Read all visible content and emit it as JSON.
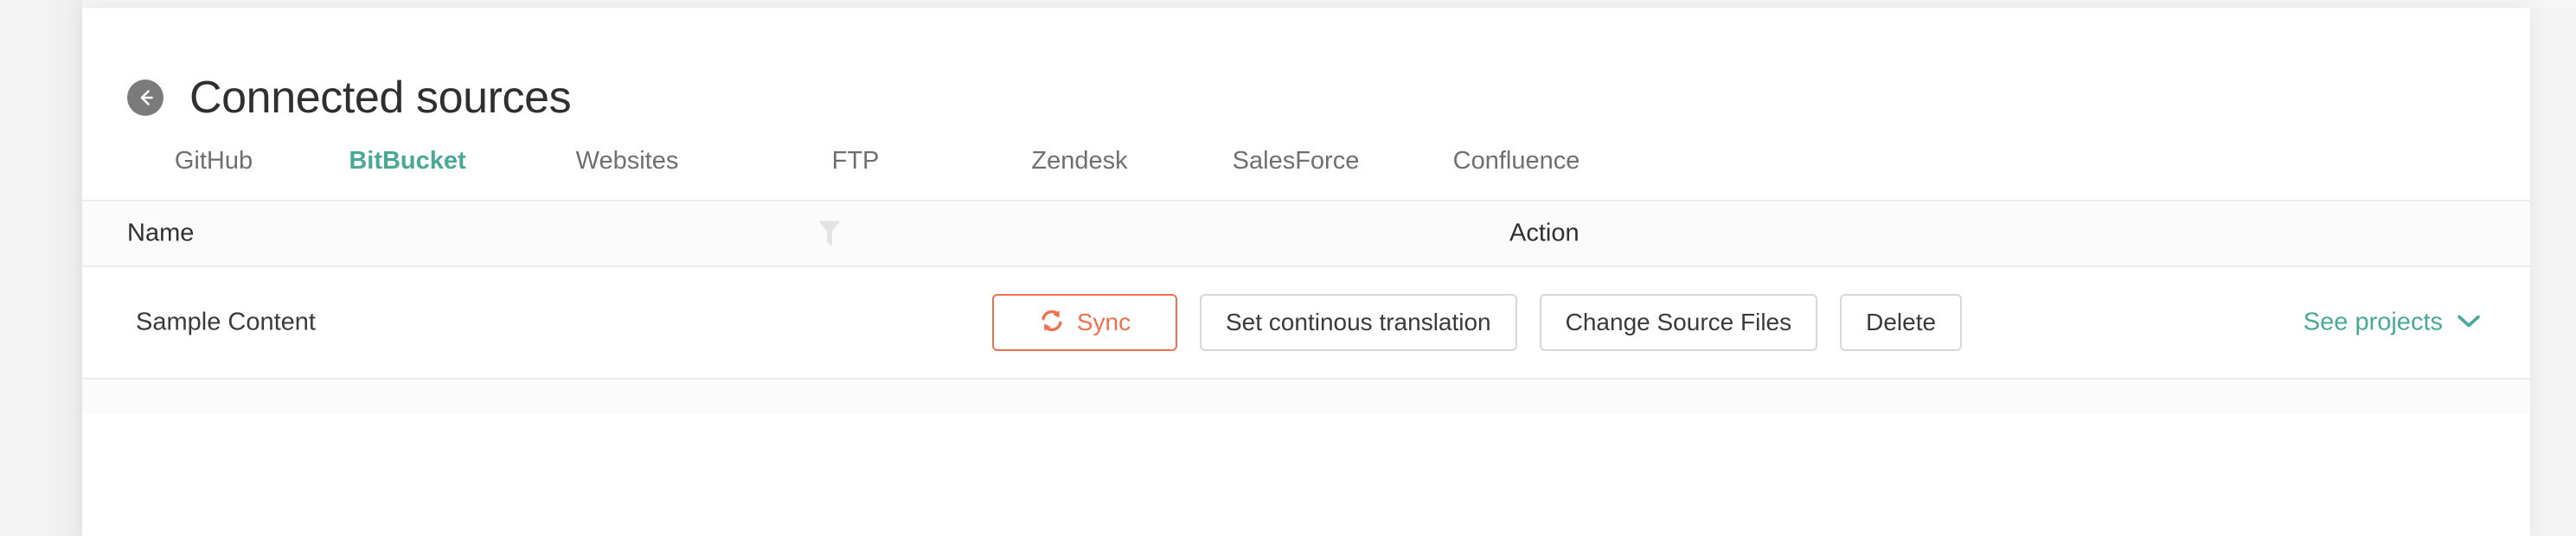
{
  "header": {
    "back_icon": "arrow-left-icon",
    "title": "Connected sources"
  },
  "tabs": [
    {
      "label": "GitHub",
      "active": false
    },
    {
      "label": "BitBucket",
      "active": true
    },
    {
      "label": "Websites",
      "active": false
    },
    {
      "label": "FTP",
      "active": false
    },
    {
      "label": "Zendesk",
      "active": false
    },
    {
      "label": "SalesForce",
      "active": false
    },
    {
      "label": "Confluence",
      "active": false
    }
  ],
  "table": {
    "columns": {
      "name": "Name",
      "filter_icon": "filter-funnel-icon",
      "action": "Action"
    },
    "rows": [
      {
        "name": "Sample Content",
        "actions": {
          "sync": "Sync",
          "sync_icon": "refresh-sync-icon",
          "set_continuous_translation": "Set continous translation",
          "change_source_files": "Change Source Files",
          "delete": "Delete"
        },
        "see_projects": "See projects",
        "see_projects_icon": "chevron-down-icon"
      }
    ]
  },
  "colors": {
    "accent_teal": "#4aa897",
    "accent_coral": "#ef7050",
    "text_primary": "#2f2f2f",
    "text_muted": "#6f6f6f",
    "border": "#ececec",
    "page_bg": "#f4f4f4",
    "card_bg": "#ffffff",
    "head_bg": "#fbfbfb"
  }
}
